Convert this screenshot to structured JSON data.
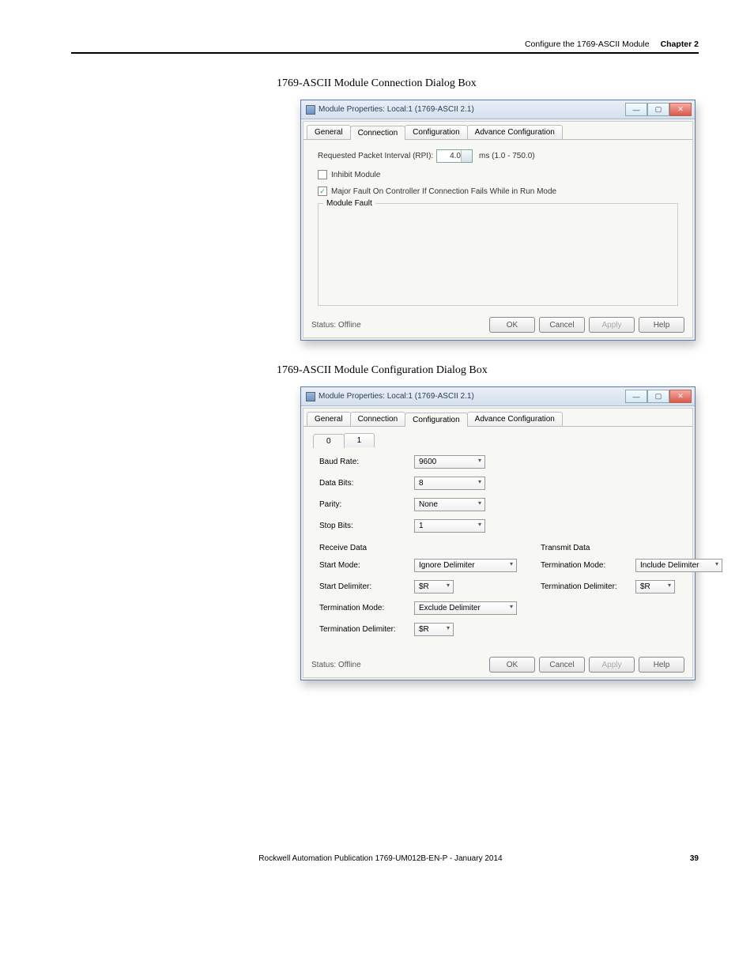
{
  "header": {
    "title": "Configure the 1769-ASCII Module",
    "chapter": "Chapter 2"
  },
  "figure1": {
    "title": "1769-ASCII Module Connection Dialog Box"
  },
  "figure2": {
    "title": "1769-ASCII Module Configuration Dialog Box"
  },
  "dialog": {
    "title": "Module Properties: Local:1 (1769-ASCII 2.1)",
    "tabs": [
      "General",
      "Connection",
      "Configuration",
      "Advance Configuration"
    ],
    "rpi_label": "Requested Packet Interval (RPI):",
    "rpi_value": "4.0",
    "rpi_range": "ms (1.0 - 750.0)",
    "inhibit": "Inhibit Module",
    "majorfault": "Major Fault On Controller If Connection Fails While in Run Mode",
    "modulefault": "Module Fault",
    "status": "Status: Offline",
    "btns": {
      "ok": "OK",
      "cancel": "Cancel",
      "apply": "Apply",
      "help": "Help"
    }
  },
  "cfg": {
    "subtabs": [
      "0",
      "1"
    ],
    "baud_lbl": "Baud Rate:",
    "baud": "9600",
    "databits_lbl": "Data Bits:",
    "databits": "8",
    "parity_lbl": "Parity:",
    "parity": "None",
    "stopbits_lbl": "Stop Bits:",
    "stopbits": "1",
    "rx_hdr": "Receive Data",
    "tx_hdr": "Transmit Data",
    "startmode_lbl": "Start Mode:",
    "startmode": "Ignore Delimiter",
    "startdelim_lbl": "Start Delimiter:",
    "startdelim": "$R",
    "rx_termmode_lbl": "Termination Mode:",
    "rx_termmode": "Exclude Delimiter",
    "rx_termdelim_lbl": "Termination Delimiter:",
    "rx_termdelim": "$R",
    "tx_termmode_lbl": "Termination Mode:",
    "tx_termmode": "Include Delimiter",
    "tx_termdelim_lbl": "Termination Delimiter:",
    "tx_termdelim": "$R"
  },
  "footer": {
    "pub": "Rockwell Automation Publication 1769-UM012B-EN-P - January 2014",
    "page": "39"
  }
}
